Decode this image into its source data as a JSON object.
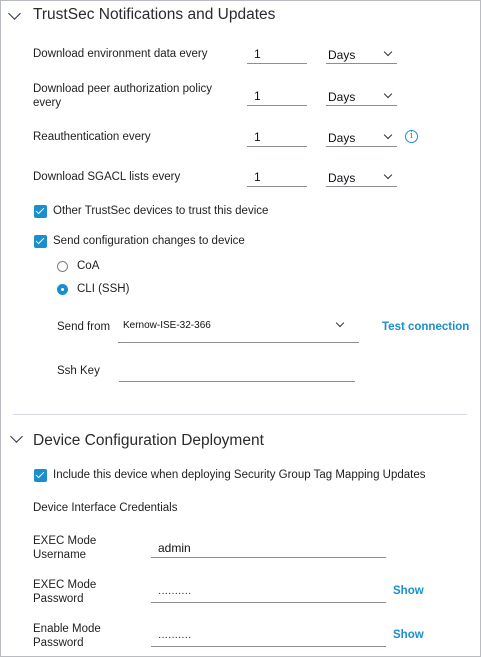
{
  "trustsec": {
    "title": "TrustSec Notifications and Updates",
    "rows": [
      {
        "label": "Download environment data every",
        "value": "1",
        "unit": "Days"
      },
      {
        "label": "Download peer authorization policy every",
        "value": "1",
        "unit": "Days"
      },
      {
        "label": "Reauthentication every",
        "value": "1",
        "unit": "Days"
      },
      {
        "label": "Download SGACL lists every",
        "value": "1",
        "unit": "Days"
      }
    ],
    "info_glyph": "i",
    "trust_checkbox_label": "Other TrustSec devices to trust this device",
    "send_config_checkbox_label": "Send configuration changes to device",
    "radio_options": [
      {
        "label": "CoA",
        "selected": false
      },
      {
        "label": "CLI (SSH)",
        "selected": true
      }
    ],
    "send_from_label": "Send from",
    "send_from_value": "Kernow-ISE-32-366",
    "test_connection_label": "Test connection",
    "ssh_key_label": "Ssh Key",
    "ssh_key_value": ""
  },
  "deployment": {
    "title": "Device Configuration Deployment",
    "include_checkbox_label": "Include this device when deploying Security Group Tag Mapping Updates",
    "credentials_heading": "Device Interface Credentials",
    "exec_username_label": "EXEC Mode Username",
    "exec_username_value": "admin",
    "exec_password_label": "EXEC Mode Password",
    "exec_password_value": "··········",
    "enable_password_label": "Enable Mode Password",
    "enable_password_value": "··········",
    "show_label": "Show"
  },
  "colors": {
    "accent": "#1b8fcd",
    "text": "#1f1f1f",
    "border": "#b8bcc2"
  }
}
